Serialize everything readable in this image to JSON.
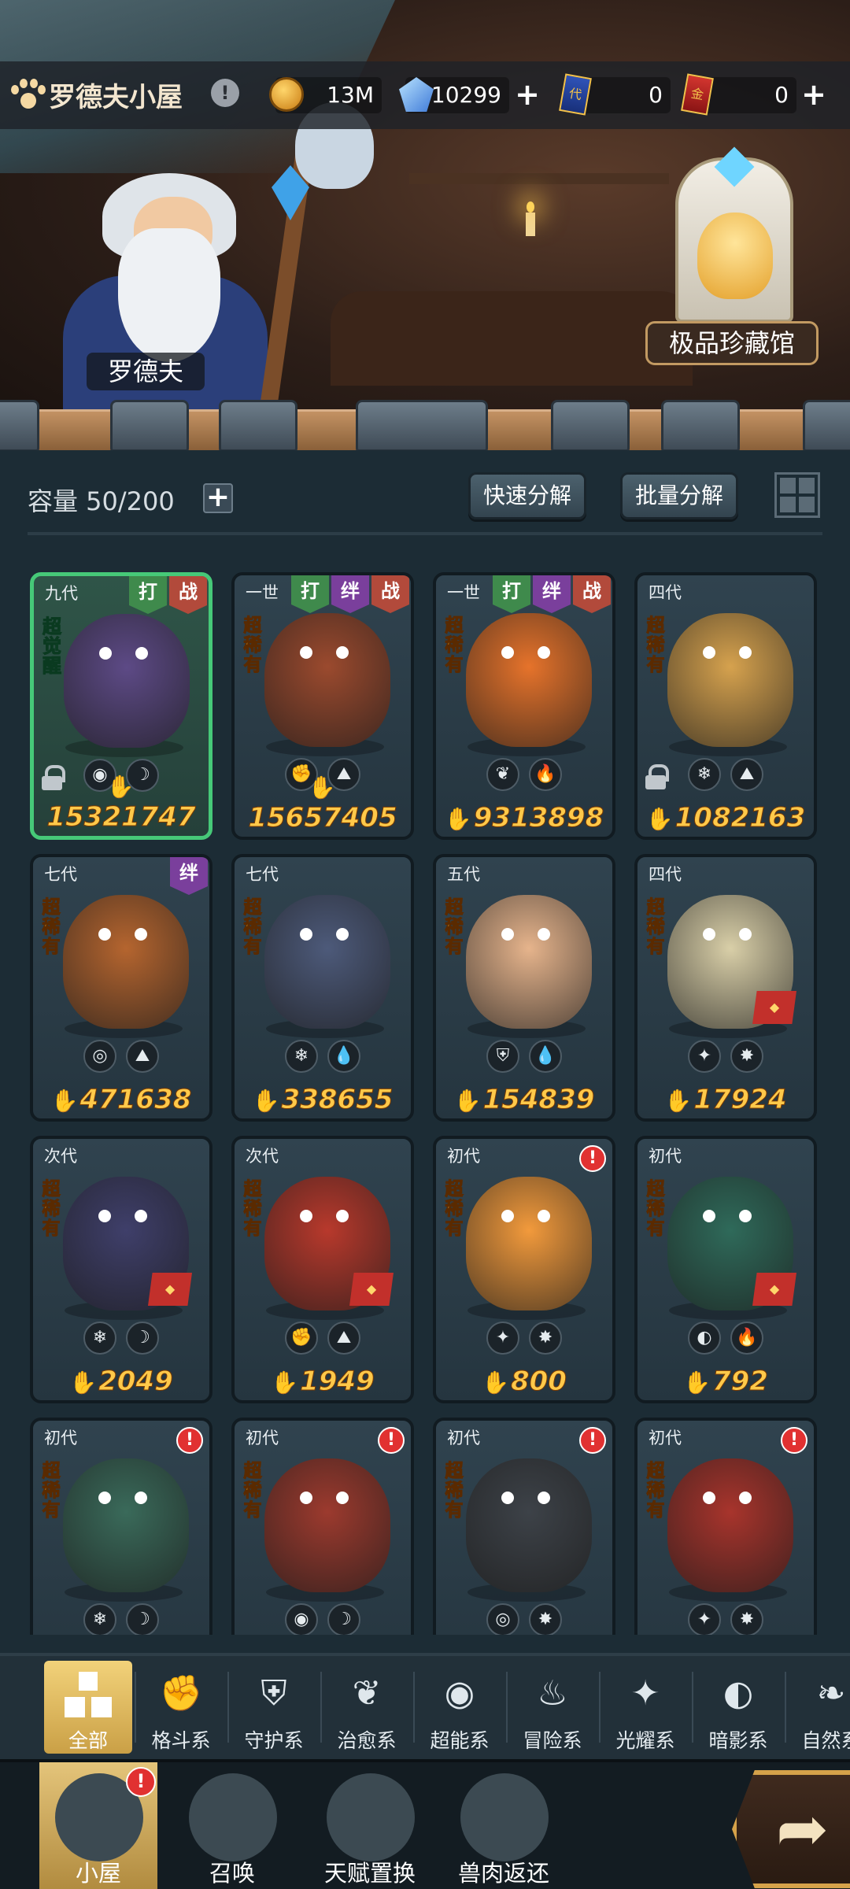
{
  "header": {
    "title": "罗德夫小屋",
    "info": "!",
    "resources": [
      {
        "name": "gold-coin",
        "value": "13M",
        "has_plus": false
      },
      {
        "name": "crystal",
        "value": "10299",
        "has_plus": true
      },
      {
        "name": "blue-ticket",
        "icon_text": "代",
        "value": "0",
        "has_plus": false
      },
      {
        "name": "red-ticket",
        "icon_text": "金",
        "value": "0",
        "has_plus": true
      }
    ]
  },
  "scene": {
    "npc_name": "罗德夫",
    "collection_label": "极品珍藏馆"
  },
  "inventory": {
    "capacity": "容量 50/200",
    "quick_decompose": "快速分解",
    "batch_decompose": "批量分解"
  },
  "cards": [
    {
      "gen": "九代",
      "tier": "超觉醒",
      "tier_type": "awake",
      "tags": [
        {
          "t": "打",
          "c": "green"
        },
        {
          "t": "战",
          "c": "red"
        }
      ],
      "icons": [
        "◉",
        "☽"
      ],
      "locked": true,
      "power": "15321747",
      "alert": false,
      "seal": false,
      "color": "#5d4a86",
      "selected": true
    },
    {
      "gen": "一世",
      "tier": "超稀有",
      "tier_type": "rare",
      "tags": [
        {
          "t": "打",
          "c": "green"
        },
        {
          "t": "绊",
          "c": "purple"
        },
        {
          "t": "战",
          "c": "red"
        }
      ],
      "icons": [
        "✊",
        "⛰"
      ],
      "locked": false,
      "power": "15657405",
      "alert": false,
      "seal": false,
      "color": "#9b4a2e",
      "selected": false
    },
    {
      "gen": "一世",
      "tier": "超稀有",
      "tier_type": "rare",
      "tags": [
        {
          "t": "打",
          "c": "green"
        },
        {
          "t": "绊",
          "c": "purple"
        },
        {
          "t": "战",
          "c": "red"
        }
      ],
      "icons": [
        "❦",
        "🔥"
      ],
      "locked": false,
      "power": "9313898",
      "alert": false,
      "seal": false,
      "color": "#e6732b",
      "selected": false
    },
    {
      "gen": "四代",
      "tier": "超稀有",
      "tier_type": "rare",
      "tags": [],
      "icons": [
        "❄",
        "⛰"
      ],
      "locked": true,
      "power": "1082163",
      "alert": false,
      "seal": false,
      "color": "#d6a24e",
      "selected": false
    },
    {
      "gen": "七代",
      "tier": "超稀有",
      "tier_type": "rare",
      "tags": [
        {
          "t": "绊",
          "c": "purple"
        }
      ],
      "icons": [
        "◎",
        "⛰"
      ],
      "locked": false,
      "power": "471638",
      "alert": false,
      "seal": false,
      "color": "#b5652f",
      "selected": false
    },
    {
      "gen": "七代",
      "tier": "超稀有",
      "tier_type": "rare",
      "tags": [],
      "icons": [
        "❄",
        "💧"
      ],
      "locked": false,
      "power": "338655",
      "alert": false,
      "seal": false,
      "color": "#4d5a7a",
      "selected": false
    },
    {
      "gen": "五代",
      "tier": "超稀有",
      "tier_type": "rare",
      "tags": [],
      "icons": [
        "⛨",
        "💧"
      ],
      "locked": false,
      "power": "154839",
      "alert": false,
      "seal": false,
      "color": "#e6b48c",
      "selected": false
    },
    {
      "gen": "四代",
      "tier": "超稀有",
      "tier_type": "rare",
      "tags": [],
      "icons": [
        "✦",
        "✸"
      ],
      "locked": false,
      "power": "17924",
      "alert": false,
      "seal": true,
      "color": "#d9cfa8",
      "selected": false
    },
    {
      "gen": "次代",
      "tier": "超稀有",
      "tier_type": "rare",
      "tags": [],
      "icons": [
        "❄",
        "☽"
      ],
      "locked": false,
      "power": "2049",
      "alert": false,
      "seal": true,
      "color": "#3f3f6a",
      "selected": false
    },
    {
      "gen": "次代",
      "tier": "超稀有",
      "tier_type": "rare",
      "tags": [],
      "icons": [
        "✊",
        "⛰"
      ],
      "locked": false,
      "power": "1949",
      "alert": false,
      "seal": true,
      "color": "#b8392c",
      "selected": false
    },
    {
      "gen": "初代",
      "tier": "超稀有",
      "tier_type": "rare",
      "tags": [],
      "icons": [
        "✦",
        "✸"
      ],
      "locked": false,
      "power": "800",
      "alert": true,
      "seal": false,
      "color": "#f29a3c",
      "selected": false
    },
    {
      "gen": "初代",
      "tier": "超稀有",
      "tier_type": "rare",
      "tags": [],
      "icons": [
        "◐",
        "🔥"
      ],
      "locked": false,
      "power": "792",
      "alert": false,
      "seal": true,
      "color": "#2f6a5a",
      "selected": false
    },
    {
      "gen": "初代",
      "tier": "超稀有",
      "tier_type": "rare",
      "tags": [],
      "icons": [
        "❄",
        "☽"
      ],
      "locked": false,
      "power": "",
      "alert": true,
      "seal": false,
      "color": "#3a6a5a",
      "selected": false
    },
    {
      "gen": "初代",
      "tier": "超稀有",
      "tier_type": "rare",
      "tags": [],
      "icons": [
        "◉",
        "☽"
      ],
      "locked": false,
      "power": "",
      "alert": true,
      "seal": false,
      "color": "#9c3a2e",
      "selected": false
    },
    {
      "gen": "初代",
      "tier": "超稀有",
      "tier_type": "rare",
      "tags": [],
      "icons": [
        "◎",
        "✸"
      ],
      "locked": false,
      "power": "",
      "alert": true,
      "seal": false,
      "color": "#3d4248",
      "selected": false
    },
    {
      "gen": "初代",
      "tier": "超稀有",
      "tier_type": "rare",
      "tags": [],
      "icons": [
        "✦",
        "✸"
      ],
      "locked": false,
      "power": "",
      "alert": true,
      "seal": false,
      "color": "#a8342c",
      "selected": false
    }
  ],
  "categories": [
    {
      "label": "全部",
      "icon": "all",
      "active": true
    },
    {
      "label": "格斗系",
      "icon": "✊",
      "active": false
    },
    {
      "label": "守护系",
      "icon": "⛨",
      "active": false
    },
    {
      "label": "治愈系",
      "icon": "❦",
      "active": false
    },
    {
      "label": "超能系",
      "icon": "◉",
      "active": false
    },
    {
      "label": "冒险系",
      "icon": "♨",
      "active": false
    },
    {
      "label": "光耀系",
      "icon": "✦",
      "active": false
    },
    {
      "label": "暗影系",
      "icon": "◐",
      "active": false
    },
    {
      "label": "自然系",
      "icon": "❧",
      "active": false
    }
  ],
  "nav": [
    {
      "label": "小屋",
      "alert": "!",
      "active": true
    },
    {
      "label": "召唤",
      "alert": "",
      "active": false
    },
    {
      "label": "天赋置换",
      "alert": "",
      "active": false
    },
    {
      "label": "兽肉返还",
      "alert": "",
      "active": false
    }
  ],
  "go_icon": "➦"
}
